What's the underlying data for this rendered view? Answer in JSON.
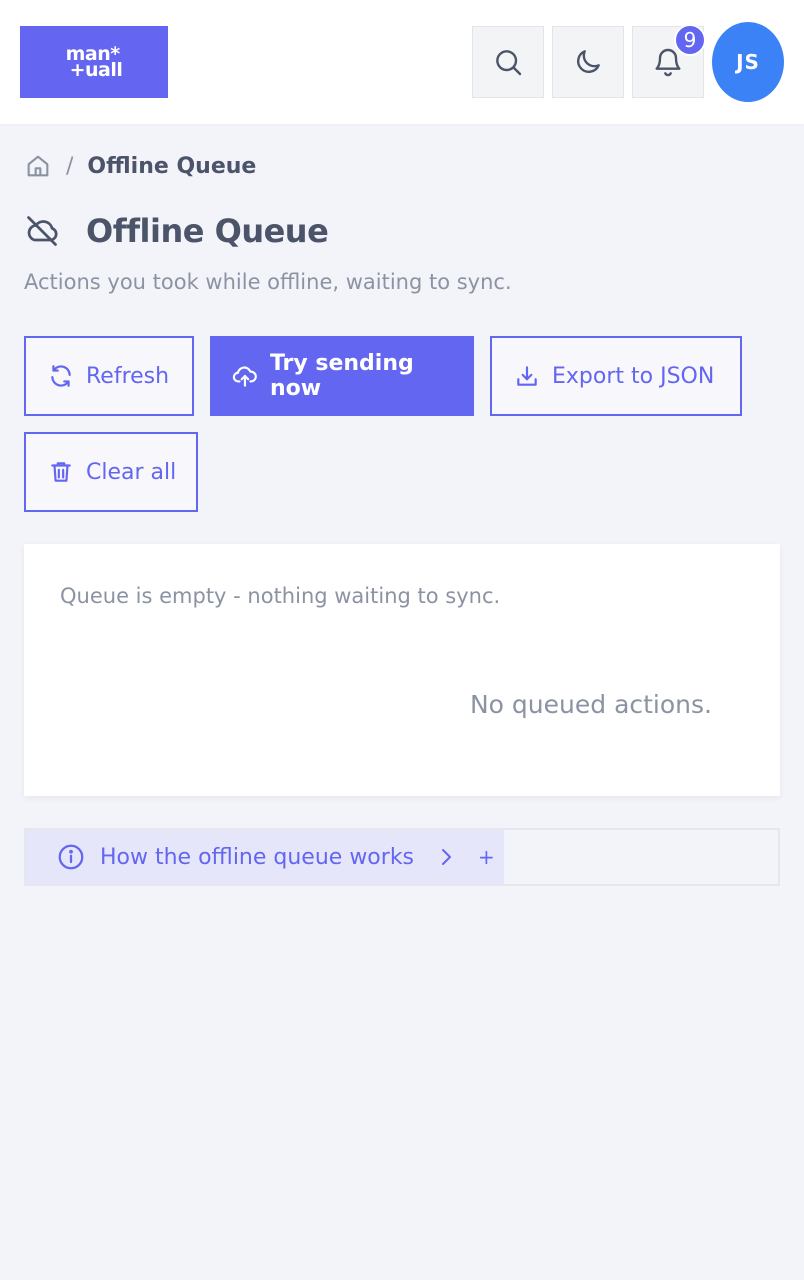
{
  "header": {
    "logo_line1": "man*",
    "logo_line2": "+uall",
    "notification_count": "9",
    "avatar_initials": "JS",
    "icons": [
      "search-icon",
      "moon-icon",
      "bell-icon"
    ]
  },
  "breadcrumb": {
    "home_icon": "home-icon",
    "separator": "/",
    "current": "Offline Queue"
  },
  "page": {
    "title": "Offline Queue",
    "title_icon": "cloud-off-icon",
    "subtitle": "Actions you took while offline, waiting to sync."
  },
  "actions": {
    "refresh": "Refresh",
    "try_sending": "Try sending now",
    "export": "Export to JSON",
    "clear": "Clear all"
  },
  "queue": {
    "status": "Queue is empty - nothing waiting to sync.",
    "empty_message": "No queued actions."
  },
  "help": {
    "label": "How the offline queue works",
    "expand": "+"
  },
  "colors": {
    "accent": "#6366f1",
    "avatar": "#3b82f6",
    "background": "#f3f4f9"
  }
}
